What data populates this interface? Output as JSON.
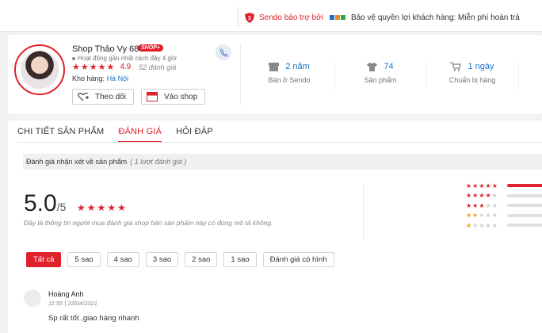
{
  "promo": {
    "sponsor": "Sendo bảo trợ bởi",
    "protection": "Bảo vệ quyền lợi khách hàng: Miễn phí hoàn trả"
  },
  "shop": {
    "name": "Shop Thảo Vy 68",
    "badge": "SHOP+",
    "online_status": "Hoạt động gần nhất cách đây 4 giờ",
    "stars": "★★★★★",
    "rating": "4.9",
    "rating_count": "52 đánh giá",
    "warehouse_label": "Kho hàng:",
    "warehouse_city": "Hà Nội",
    "follow_label": "Theo dõi",
    "visit_label": "Vào shop",
    "stats": [
      {
        "value": "2 năm",
        "label": "Bán ở Sendo",
        "icon": "store-icon"
      },
      {
        "value": "74",
        "label": "Sản phẩm",
        "icon": "tshirt-icon"
      },
      {
        "value": "1 ngày",
        "label": "Chuẩn bị hàng",
        "icon": "cart-icon"
      }
    ]
  },
  "tabs": [
    {
      "label": "CHI TIẾT SẢN PHẨM"
    },
    {
      "label": "ĐÁNH GIÁ"
    },
    {
      "label": "HỎI ĐÁP"
    }
  ],
  "reviews": {
    "heading": "Đánh giá nhận xét về sản phẩm",
    "count_text": "( 1 lượt đánh giá )",
    "score": "5.0",
    "score_out_of": "/5",
    "score_stars": "★★★★★",
    "note": "Đây là thông tin người mua đánh giá shop bán sản phẩm này có đúng mô tả không.",
    "distribution": [
      {
        "stars": 5,
        "fraction": 1.0
      },
      {
        "stars": 4,
        "fraction": 0
      },
      {
        "stars": 3,
        "fraction": 0
      },
      {
        "stars": 2,
        "fraction": 0
      },
      {
        "stars": 1,
        "fraction": 0
      }
    ],
    "filters": [
      "Tất cả",
      "5 sao",
      "4 sao",
      "3 sao",
      "2 sao",
      "1 sao",
      "Đánh giá có hình"
    ],
    "items": [
      {
        "name": "Hoàng Anh",
        "time": "11:55 | 23/04/2021",
        "text": "Sp rất tốt ,giao hàng nhanh"
      }
    ]
  },
  "colors": {
    "accent": "#e0202a",
    "link": "#1a73c9"
  }
}
